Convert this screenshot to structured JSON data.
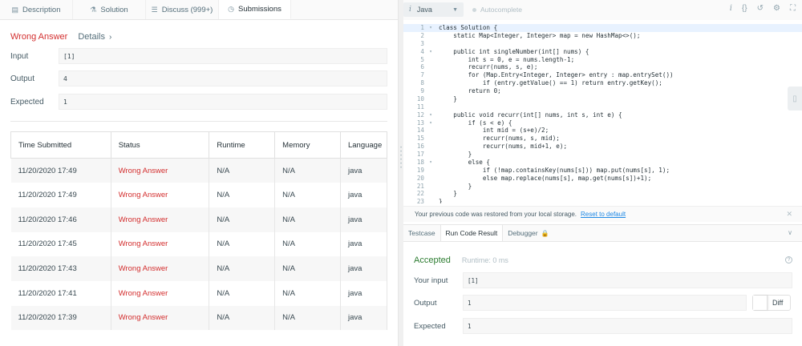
{
  "left_tabs": [
    {
      "icon": "▤",
      "label": "Description"
    },
    {
      "icon": "⚗",
      "label": "Solution"
    },
    {
      "icon": "☰",
      "label": "Discuss (999+)"
    },
    {
      "icon": "◷",
      "label": "Submissions"
    }
  ],
  "result": {
    "status": "Wrong Answer",
    "details": "Details",
    "chevron": "›"
  },
  "io": {
    "input_label": "Input",
    "input_value": "[1]",
    "output_label": "Output",
    "output_value": "4",
    "expected_label": "Expected",
    "expected_value": "1"
  },
  "table": {
    "headers": [
      "Time Submitted",
      "Status",
      "Runtime",
      "Memory",
      "Language"
    ],
    "rows": [
      [
        "11/20/2020 17:49",
        "Wrong Answer",
        "N/A",
        "N/A",
        "java"
      ],
      [
        "11/20/2020 17:49",
        "Wrong Answer",
        "N/A",
        "N/A",
        "java"
      ],
      [
        "11/20/2020 17:46",
        "Wrong Answer",
        "N/A",
        "N/A",
        "java"
      ],
      [
        "11/20/2020 17:45",
        "Wrong Answer",
        "N/A",
        "N/A",
        "java"
      ],
      [
        "11/20/2020 17:43",
        "Wrong Answer",
        "N/A",
        "N/A",
        "java"
      ],
      [
        "11/20/2020 17:41",
        "Wrong Answer",
        "N/A",
        "N/A",
        "java"
      ],
      [
        "11/20/2020 17:39",
        "Wrong Answer",
        "N/A",
        "N/A",
        "java"
      ]
    ]
  },
  "editor": {
    "language": "Java",
    "language_icon": "i",
    "autocomplete": "Autocomplete",
    "lines": [
      {
        "n": "1",
        "fold": "▾",
        "code": "class Solution {"
      },
      {
        "n": "2",
        "fold": "",
        "code": "    static Map<Integer, Integer> map = new HashMap<>();"
      },
      {
        "n": "3",
        "fold": "",
        "code": ""
      },
      {
        "n": "4",
        "fold": "▾",
        "code": "    public int singleNumber(int[] nums) {"
      },
      {
        "n": "5",
        "fold": "",
        "code": "        int s = 0, e = nums.length-1;"
      },
      {
        "n": "6",
        "fold": "",
        "code": "        recurr(nums, s, e);"
      },
      {
        "n": "7",
        "fold": "",
        "code": "        for (Map.Entry<Integer, Integer> entry : map.entrySet())"
      },
      {
        "n": "8",
        "fold": "",
        "code": "            if (entry.getValue() == 1) return entry.getKey();"
      },
      {
        "n": "9",
        "fold": "",
        "code": "        return 0;"
      },
      {
        "n": "10",
        "fold": "",
        "code": "    }"
      },
      {
        "n": "11",
        "fold": "",
        "code": ""
      },
      {
        "n": "12",
        "fold": "▾",
        "code": "    public void recurr(int[] nums, int s, int e) {"
      },
      {
        "n": "13",
        "fold": "▾",
        "code": "        if (s < e) {"
      },
      {
        "n": "14",
        "fold": "",
        "code": "            int mid = (s+e)/2;"
      },
      {
        "n": "15",
        "fold": "",
        "code": "            recurr(nums, s, mid);"
      },
      {
        "n": "16",
        "fold": "",
        "code": "            recurr(nums, mid+1, e);"
      },
      {
        "n": "17",
        "fold": "",
        "code": "        }"
      },
      {
        "n": "18",
        "fold": "▾",
        "code": "        else {"
      },
      {
        "n": "19",
        "fold": "",
        "code": "            if (!map.containsKey(nums[s])) map.put(nums[s], 1);"
      },
      {
        "n": "20",
        "fold": "",
        "code": "            else map.replace(nums[s], map.get(nums[s])+1);"
      },
      {
        "n": "21",
        "fold": "",
        "code": "        }"
      },
      {
        "n": "22",
        "fold": "",
        "code": "    }"
      },
      {
        "n": "23",
        "fold": "",
        "code": "}"
      }
    ]
  },
  "toolbar_icons": [
    {
      "name": "info-icon",
      "glyph": "i"
    },
    {
      "name": "braces-icon",
      "glyph": "{}"
    },
    {
      "name": "reset-icon",
      "glyph": "↺"
    },
    {
      "name": "settings-icon",
      "glyph": "⚙"
    },
    {
      "name": "fullscreen-icon",
      "glyph": "⛶"
    }
  ],
  "restore": {
    "text": "Your previous code was restored from your local storage.",
    "link": "Reset to default",
    "close": "✕"
  },
  "console_tabs": [
    "Testcase",
    "Run Code Result",
    "Debugger"
  ],
  "run_result": {
    "status": "Accepted",
    "runtime": "Runtime: 0 ms",
    "your_input_label": "Your input",
    "your_input_value": "[1]",
    "output_label": "Output",
    "output_value": "1",
    "expected_label": "Expected",
    "expected_value": "1",
    "diff_label": "Diff"
  }
}
